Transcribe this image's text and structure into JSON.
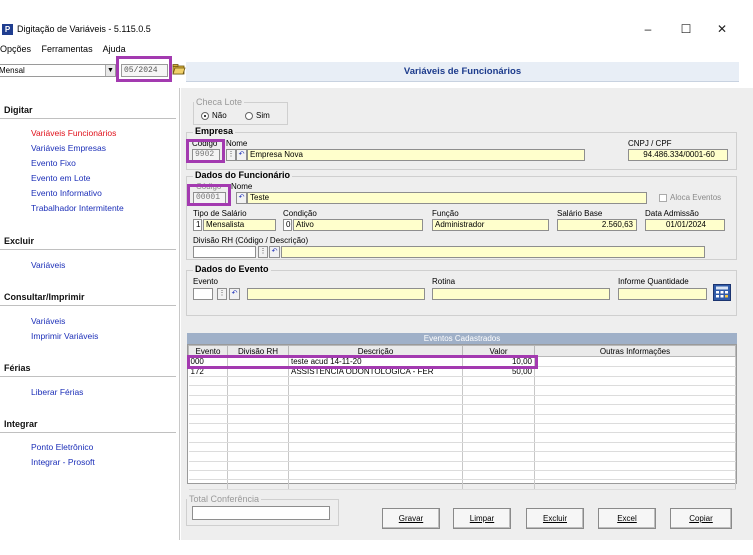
{
  "window": {
    "title": "Digitação de Variáveis - 5.115.0.5",
    "app_icon": "P",
    "minimize": "–",
    "maximize": "☐",
    "close": "✕"
  },
  "menu": [
    "Opções",
    "Ferramentas",
    "Ajuda"
  ],
  "toolbar": {
    "period_type": "Mensal",
    "period": "05/2024",
    "open_icon": "folder-open-icon"
  },
  "header": {
    "title": "Variáveis de Funcionários"
  },
  "sidebar": {
    "sections": [
      {
        "title": "Digitar",
        "items": [
          "Variáveis Funcionários",
          "Variáveis Empresas",
          "Evento Fixo",
          "Evento em Lote",
          "Evento Informativo",
          "Trabalhador Intermitente"
        ]
      },
      {
        "title": "Excluir",
        "items": [
          "Variáveis"
        ]
      },
      {
        "title": "Consultar/Imprimir",
        "items": [
          "Variáveis",
          "Imprimir Variáveis"
        ]
      },
      {
        "title": "Férias",
        "items": [
          "Liberar Férias"
        ]
      },
      {
        "title": "Integrar",
        "items": [
          "Ponto Eletrônico",
          "Integrar - Prosoft"
        ]
      }
    ],
    "active_item": "Variáveis Funcionários"
  },
  "checa_lote": {
    "legend": "Checa Lote",
    "options": [
      "Não",
      "Sim"
    ],
    "selected": "Não"
  },
  "empresa": {
    "title": "Empresa",
    "codigo_label": "Código",
    "nome_label": "Nome",
    "codigo": "9902",
    "nome": "Empresa Nova",
    "cnpj_label": "CNPJ / CPF",
    "cnpj": "94.486.334/0001-60"
  },
  "funcionario": {
    "title": "Dados do Funcionário",
    "codigo_label": "Código",
    "nome_label": "Nome",
    "codigo": "00001",
    "nome": "Teste",
    "aloca_eventos": "Aloca Eventos",
    "tipo_salario_label": "Tipo de Salário",
    "tipo_salario_code": "1",
    "tipo_salario": "Mensalista",
    "condicao_label": "Condição",
    "condicao_code": "0",
    "condicao": "Ativo",
    "funcao_label": "Função",
    "funcao": "Administrador",
    "salario_base_label": "Salário Base",
    "salario_base": "2.560,63",
    "data_admissao_label": "Data Admissão",
    "data_admissao": "01/01/2024",
    "divisao_label": "Divisão RH (Código / Descrição)"
  },
  "evento": {
    "title": "Dados do Evento",
    "evento_label": "Evento",
    "rotina_label": "Rotina",
    "informe_label": "Informe Quantidade"
  },
  "grid": {
    "title": "Eventos Cadastrados",
    "columns": [
      "Evento",
      "Divisão RH",
      "Descrição",
      "Valor",
      "Outras Informações"
    ],
    "rows": [
      [
        "000",
        "",
        "teste acud 14-11-20",
        "10,00",
        ""
      ],
      [
        "172",
        "",
        "ASSISTÊNCIA ODONTOLÓGICA - FÉR",
        "50,00",
        ""
      ]
    ],
    "empty_rows": 12
  },
  "total": {
    "legend": "Total Conferência",
    "value": ""
  },
  "buttons": {
    "gravar": "Gravar",
    "limpar": "Limpar",
    "excluir": "Excluir",
    "excel": "Excel",
    "copiar": "Copiar"
  },
  "colors": {
    "highlight": "#a33ab0",
    "link": "#1c2fb8",
    "active_link": "#e0101a",
    "header": "#1c3b8c"
  }
}
